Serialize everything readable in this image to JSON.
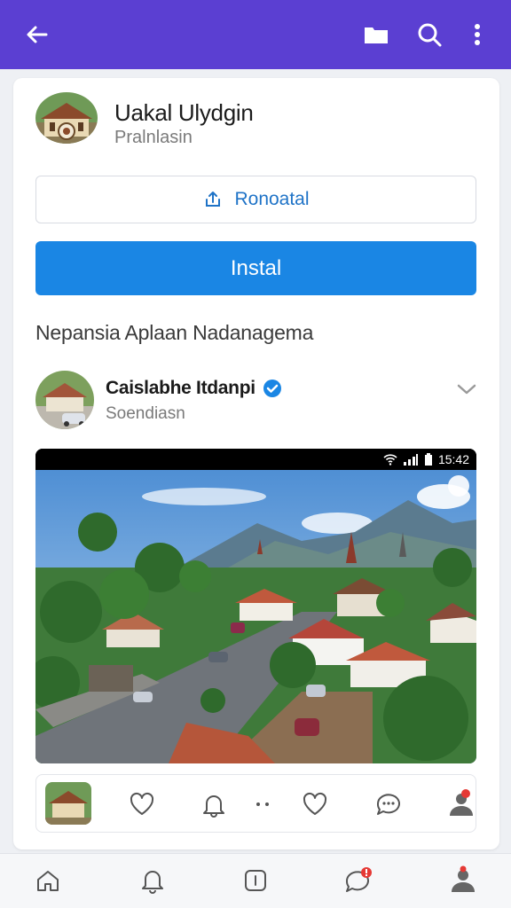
{
  "topbar": {
    "color": "#5b3fd2",
    "icons": [
      "back-arrow-icon",
      "folder-icon",
      "search-icon",
      "more-vert-icon"
    ]
  },
  "app": {
    "title": "Uakal Ulydgin",
    "subtitle": "Pralnlasin",
    "secondary_button": "Ronoatal",
    "primary_button": "Instal"
  },
  "section": {
    "title": "Nepansia Aplaan Nadanagema"
  },
  "post": {
    "name": "Caislabhe Itdanpi",
    "subtitle": "Soendiasn",
    "verified": true,
    "status_time": "15:42"
  },
  "colors": {
    "accent": "#5b3fd2",
    "primary_button": "#1a86e4",
    "link": "#1f73c7",
    "badge": "#e53935"
  }
}
